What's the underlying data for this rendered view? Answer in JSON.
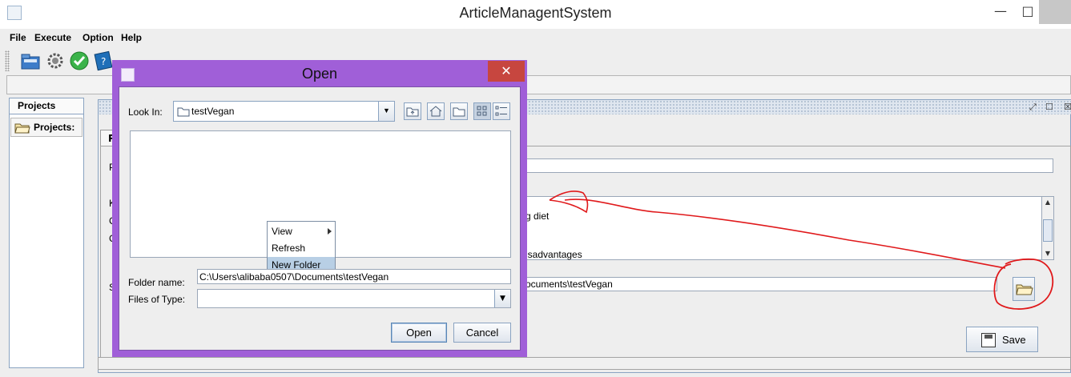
{
  "window": {
    "title": "ArticleManagentSystem"
  },
  "menu": {
    "file": "File",
    "execute": "Execute",
    "option": "Option",
    "help": "Help"
  },
  "toolbar": {
    "icons": [
      "open-icon",
      "settings-icon",
      "check-icon",
      "help-book-icon"
    ]
  },
  "left_panel": {
    "tab_label": "Projects",
    "header_label": "Projects:"
  },
  "inner_tab": {
    "label": "P"
  },
  "content": {
    "labels": {
      "name_initial": "P",
      "keywords_initial": "K",
      "line2_initial": "C",
      "line3_initial": "C",
      "path_initial": "S"
    },
    "description_lines": [
      "g diet",
      "isadvantages"
    ],
    "path_value": "ocuments\\testVegan",
    "save_label": "Save"
  },
  "dialog": {
    "title": "Open",
    "close_glyph": "✕",
    "look_in_label": "Look In:",
    "look_in_value": "testVegan",
    "context_menu": [
      {
        "label": "View",
        "has_submenu": true,
        "selected": false
      },
      {
        "label": "Refresh",
        "has_submenu": false,
        "selected": false
      },
      {
        "label": "New Folder",
        "has_submenu": false,
        "selected": true
      }
    ],
    "folder_name_label": "Folder name:",
    "folder_name_value": "C:\\Users\\alibaba0507\\Documents\\testVegan",
    "files_of_type_label": "Files of Type:",
    "files_of_type_value": "",
    "open_label": "Open",
    "cancel_label": "Cancel"
  },
  "colors": {
    "dialog_frame": "#a05fd8",
    "close_button": "#c7463f",
    "annotation": "#e0191b",
    "selection": "#b8cfe5"
  }
}
